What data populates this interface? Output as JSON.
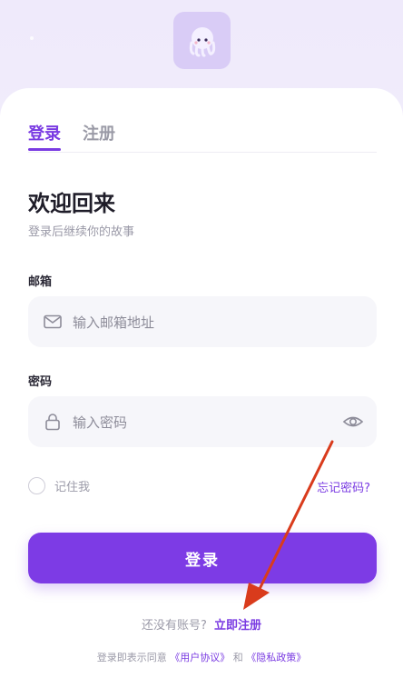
{
  "logo": {
    "icon": "squid-mascot-icon"
  },
  "tabs": {
    "login": "登录",
    "register": "注册"
  },
  "heading": {
    "title": "欢迎回来",
    "subtitle": "登录后继续你的故事"
  },
  "email": {
    "label": "邮箱",
    "placeholder": "输入邮箱地址",
    "icon": "mail-icon"
  },
  "password": {
    "label": "密码",
    "placeholder": "输入密码",
    "icon": "lock-icon",
    "toggle_icon": "eye-icon"
  },
  "options": {
    "remember_label": "记住我",
    "forgot_label": "忘记密码?"
  },
  "submit": {
    "label": "登录"
  },
  "signup": {
    "prompt": "还没有账号?",
    "link": "立即注册"
  },
  "agreement": {
    "prefix": "登录即表示同意",
    "terms": "《用户协议》",
    "and": "和",
    "privacy": "《隐私政策》"
  },
  "colors": {
    "accent": "#7d3be5",
    "annotation_arrow": "#d93b1c"
  }
}
